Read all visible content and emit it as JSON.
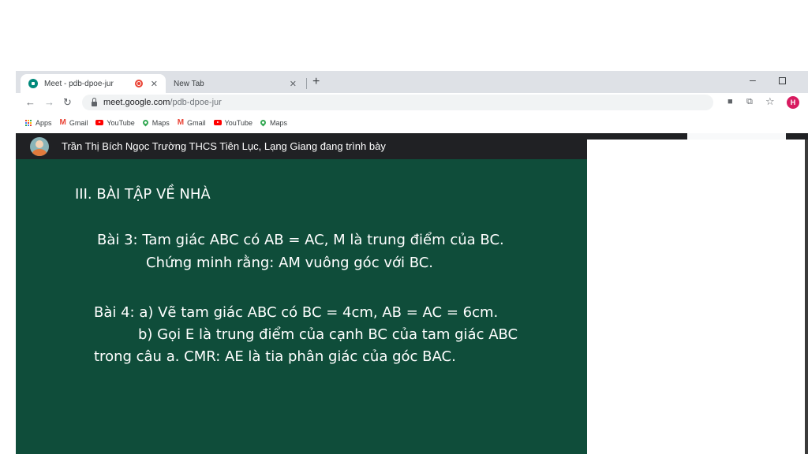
{
  "tabs": [
    {
      "title": "Meet - pdb-dpoe-jur",
      "active": true,
      "recording": true
    },
    {
      "title": "New Tab",
      "active": false
    }
  ],
  "toolbar": {
    "url_host": "meet.google.com",
    "url_path": "/pdb-dpoe-jur",
    "avatar_letter": "H"
  },
  "bookmarks": [
    {
      "label": "Apps",
      "icon": "apps-icon"
    },
    {
      "label": "Gmail",
      "icon": "gmail-icon"
    },
    {
      "label": "YouTube",
      "icon": "youtube-icon"
    },
    {
      "label": "Maps",
      "icon": "maps-icon"
    },
    {
      "label": "Gmail",
      "icon": "gmail-icon"
    },
    {
      "label": "YouTube",
      "icon": "youtube-icon"
    },
    {
      "label": "Maps",
      "icon": "maps-icon"
    }
  ],
  "meet": {
    "presenting_text": "Trần Thị Bích Ngọc Trường THCS Tiên Lục, Lạng Giang đang trình bày"
  },
  "board": {
    "heading": "III. BÀI TẬP VỀ NHÀ",
    "bai3_line1": "Bài 3: Tam giác ABC có AB = AC, M là trung điểm của BC.",
    "bai3_line2": "Chứng minh rằng: AM vuông góc với BC.",
    "bai4_line1": "Bài 4: a) Vẽ tam giác ABC có BC = 4cm, AB = AC = 6cm.",
    "bai4_line2": "b) Gọi E là trung điểm của cạnh BC của tam giác ABC",
    "bai4_line3": "trong câu a. CMR: AE là tia phân giác của góc BAC."
  },
  "colors": {
    "board_background": "#0f4d3a",
    "meet_header": "#202124",
    "profile": "#d81b60",
    "recording": "#ea4335"
  }
}
